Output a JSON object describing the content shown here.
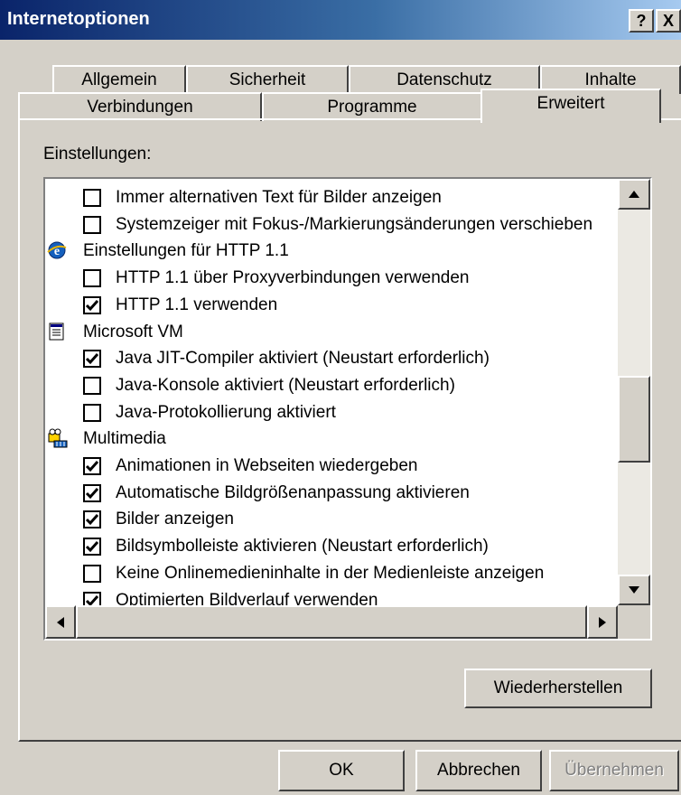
{
  "window": {
    "title": "Internetoptionen",
    "help_label": "?",
    "close_label": "X"
  },
  "tabs_row1": [
    "Allgemein",
    "Sicherheit",
    "Datenschutz",
    "Inhalte"
  ],
  "tabs_row2": [
    "Verbindungen",
    "Programme",
    "Erweitert"
  ],
  "settings_label": "Einstellungen:",
  "items": [
    {
      "type": "check",
      "label": "Immer alternativen Text für Bilder anzeigen",
      "checked": false
    },
    {
      "type": "check",
      "label": "Systemzeiger mit Fokus-/Markierungsänderungen verschieben",
      "checked": false
    },
    {
      "type": "group",
      "label": "Einstellungen für HTTP 1.1",
      "icon": "ie-icon"
    },
    {
      "type": "check",
      "label": "HTTP 1.1 über Proxyverbindungen verwenden",
      "checked": false
    },
    {
      "type": "check",
      "label": "HTTP 1.1 verwenden",
      "checked": true
    },
    {
      "type": "group",
      "label": "Microsoft VM",
      "icon": "document-icon"
    },
    {
      "type": "check",
      "label": "Java JIT-Compiler aktiviert (Neustart erforderlich)",
      "checked": true
    },
    {
      "type": "check",
      "label": "Java-Konsole aktiviert (Neustart erforderlich)",
      "checked": false
    },
    {
      "type": "check",
      "label": "Java-Protokollierung aktiviert",
      "checked": false
    },
    {
      "type": "group",
      "label": "Multimedia",
      "icon": "multimedia-icon"
    },
    {
      "type": "check",
      "label": "Animationen in Webseiten wiedergeben",
      "checked": true
    },
    {
      "type": "check",
      "label": "Automatische Bildgrößenanpassung aktivieren",
      "checked": true
    },
    {
      "type": "check",
      "label": "Bilder anzeigen",
      "checked": true
    },
    {
      "type": "check",
      "label": "Bildsymbolleiste aktivieren (Neustart erforderlich)",
      "checked": true
    },
    {
      "type": "check",
      "label": "Keine Onlinemedieninhalte in der Medienleiste anzeigen",
      "checked": false
    },
    {
      "type": "check",
      "label": "Optimierten Bildverlauf verwenden",
      "checked": true
    }
  ],
  "restore_button": "Wiederherstellen",
  "buttons": {
    "ok": "OK",
    "cancel": "Abbrechen",
    "apply": "Übernehmen"
  }
}
